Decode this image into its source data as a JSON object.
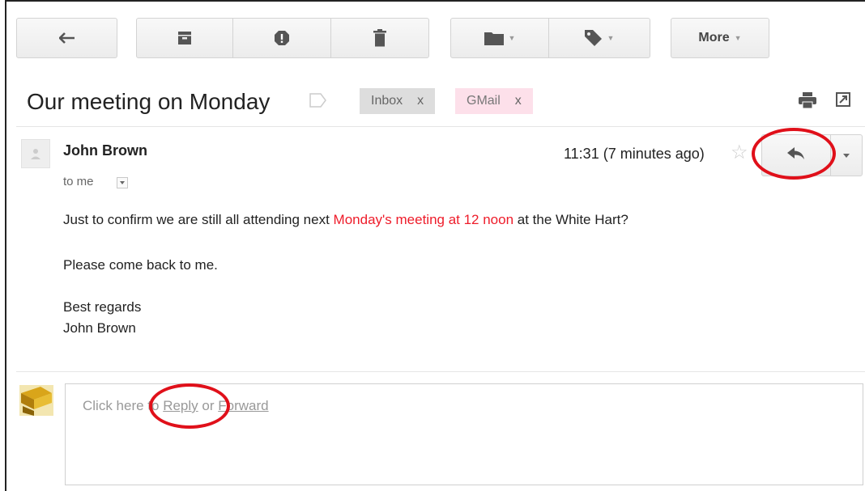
{
  "toolbar": {
    "back_icon": "back-arrow-icon",
    "archive_icon": "archive-icon",
    "spam_icon": "report-spam-icon",
    "delete_icon": "trash-icon",
    "move_icon": "folder-icon",
    "labels_icon": "label-icon",
    "more_label": "More"
  },
  "thread": {
    "subject": "Our meeting on Monday",
    "labels": [
      {
        "name": "Inbox",
        "remove": "x",
        "color": "#dddddd"
      },
      {
        "name": "GMail",
        "remove": "x",
        "color": "#fde0ea"
      }
    ],
    "print_icon": "print-icon",
    "new_window_icon": "new-window-icon"
  },
  "message": {
    "sender": "John Brown",
    "recipient": "to me",
    "timestamp": "11:31 (7 minutes ago)",
    "star": "☆",
    "body": {
      "line1_before": "Just to confirm we are still all attending next ",
      "line1_highlight": "Monday's meeting at 12 noon",
      "line1_after": " at the White Hart?",
      "line2": "Please come back to me.",
      "closing": "Best regards",
      "signature": "John Brown"
    },
    "highlight_color": "#ee1c2a"
  },
  "reply_box": {
    "prefix": "Click here to ",
    "reply_link": "Reply",
    "middle": " or ",
    "forward_link": "Forward"
  },
  "annotation_color": "#e0101a"
}
